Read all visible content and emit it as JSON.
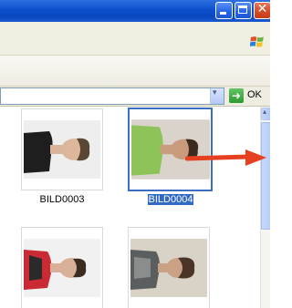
{
  "go_button": {
    "label": "OK",
    "icon": "green-arrow-right-icon"
  },
  "thumbnails": [
    {
      "caption": "BILD0003",
      "selected": false
    },
    {
      "caption": "BILD0004",
      "selected": true
    },
    {
      "caption": "",
      "selected": false
    },
    {
      "caption": "",
      "selected": false
    }
  ],
  "colors": {
    "titlebar": "#0d4fcb",
    "selection": "#316ac5",
    "selection_border": "#3a6fc4",
    "annotation_arrow": "#e5401f"
  }
}
